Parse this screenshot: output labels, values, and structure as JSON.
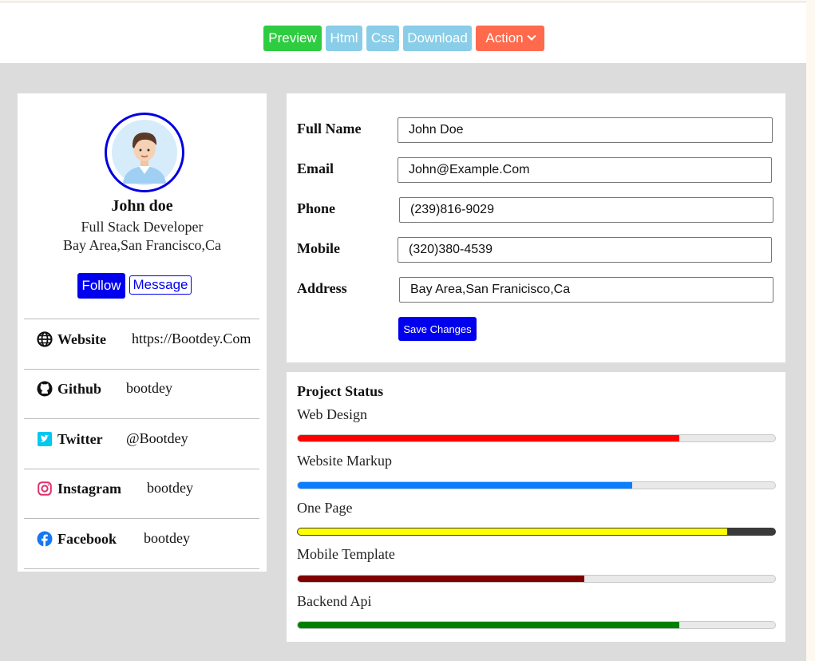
{
  "toolbar": {
    "preview": "Preview",
    "html": "Html",
    "css": "Css",
    "download": "Download",
    "action": "Action"
  },
  "profile": {
    "name": "John doe",
    "role": "Full Stack Developer",
    "location": "Bay Area,San Francisco,Ca",
    "follow": "Follow",
    "message": "Message",
    "social": [
      {
        "label": "Website",
        "value": "https://Bootdey.Com",
        "icon": "globe-icon"
      },
      {
        "label": "Github",
        "value": "bootdey",
        "icon": "github-icon"
      },
      {
        "label": "Twitter",
        "value": "@Bootdey",
        "icon": "twitter-icon"
      },
      {
        "label": "Instagram",
        "value": "bootdey",
        "icon": "instagram-icon"
      },
      {
        "label": "Facebook",
        "value": "bootdey",
        "icon": "facebook-icon"
      }
    ]
  },
  "form": {
    "fields": [
      {
        "label": "Full Name",
        "value": "John Doe"
      },
      {
        "label": "Email",
        "value": "John@Example.Com"
      },
      {
        "label": "Phone",
        "value": "(239)816-9029"
      },
      {
        "label": "Mobile",
        "value": "(320)380-4539"
      },
      {
        "label": "Address",
        "value": "Bay Area,San Franicisco,Ca"
      }
    ],
    "save": "Save Changes"
  },
  "project": {
    "title": "Project Status",
    "items": [
      {
        "label": "Web Design",
        "percent": 80,
        "color": "#ff0000"
      },
      {
        "label": "Website Markup",
        "percent": 70,
        "color": "#0b7dff"
      },
      {
        "label": "One Page",
        "percent": 90,
        "color": "#ffff00"
      },
      {
        "label": "Mobile Template",
        "percent": 60,
        "color": "#800000"
      },
      {
        "label": "Backend Api",
        "percent": 80,
        "color": "#008000"
      }
    ]
  },
  "colors": {
    "primary": "#0000ee",
    "preview_green": "#2ecc40",
    "light_blue": "#89cde8",
    "action_orange": "#ff6a4d"
  }
}
